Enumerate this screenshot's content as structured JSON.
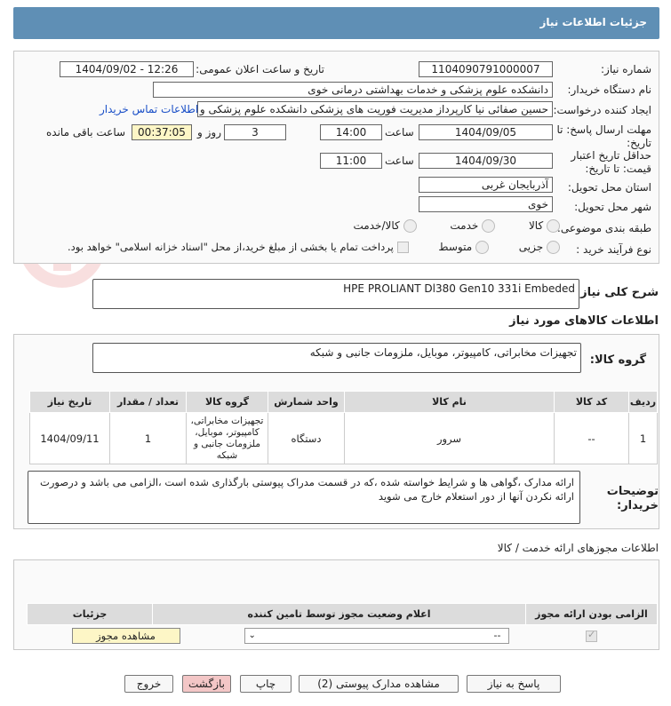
{
  "page_title": "جزئیات اطلاعات نیاز",
  "fields": {
    "need_number": {
      "label": "شماره نیاز:",
      "value": "1104090791000007"
    },
    "announce_datetime": {
      "label": "تاریخ و ساعت اعلان عمومی:",
      "value": "1404/09/02 - 12:26"
    },
    "buyer_org": {
      "label": "نام دستگاه خریدار:",
      "value": "دانشکده علوم پزشکی و خدمات بهداشتی درمانی خوی"
    },
    "requester": {
      "label": "ایجاد کننده درخواست:",
      "value": "حسین صفائی نیا کارپرداز مدیریت فوریت های پزشکی دانشکده علوم پزشکی و خدمات"
    },
    "contact_link": "اطلاعات تماس خریدار",
    "reply_deadline": {
      "label": "مهلت ارسال پاسخ: تا تاریخ:",
      "date": "1404/09/05",
      "time_label": "ساعت",
      "time": "14:00",
      "days": "3",
      "days_label": "روز و",
      "remaining": "00:37:05",
      "remaining_label": "ساعت باقی مانده"
    },
    "price_validity": {
      "label": "حداقل تاریخ اعتبار قیمت: تا تاریخ:",
      "date": "1404/09/30",
      "time_label": "ساعت",
      "time": "11:00"
    },
    "province": {
      "label": "استان محل تحویل:",
      "value": "آذربایجان غربی"
    },
    "city": {
      "label": "شهر محل تحویل:",
      "value": "خوی"
    },
    "category": {
      "label": "طبقه بندی موضوعی:",
      "options": [
        "کالا",
        "خدمت",
        "کالا/خدمت"
      ]
    },
    "process": {
      "label": "نوع فرآیند خرید :",
      "options": [
        "جزیی",
        "متوسط"
      ],
      "payment_note": "پرداخت تمام یا بخشی از مبلغ خرید،از محل \"اسناد خزانه اسلامی\" خواهد بود."
    }
  },
  "summary": {
    "label": "شرح کلی نیاز:",
    "value": "HPE PROLIANT Dl380 Gen10 331i Embeded"
  },
  "goods_info_title": "اطلاعات کالاهای مورد نیاز",
  "goods_group": {
    "label": "گروه کالا:",
    "value": "تجهیزات مخابراتی، کامپیوتر، موبایل، ملزومات جانبی و شبکه"
  },
  "goods_table": {
    "headers": [
      "ردیف",
      "کد کالا",
      "نام کالا",
      "واحد شمارش",
      "گروه کالا",
      "تعداد / مقدار",
      "تاریخ نیاز"
    ],
    "rows": [
      [
        "1",
        "--",
        "سرور",
        "دستگاه",
        "تجهیزات مخابراتی، کامپیوتر، موبایل، ملزومات جانبی و شبکه",
        "1",
        "1404/09/11"
      ]
    ]
  },
  "buyer_notes": {
    "label": "توضیحات خریدار:",
    "value": "ارائه مدارک ،گواهی ها و شرایط خواسته شده ،که در قسمت مدراک پیوستی بارگذاری شده است ،الزامی می باشد و درصورت ارائه نکردن آنها از دور استعلام خارج می شوید"
  },
  "permits_title": "اطلاعات مجوزهای ارائه خدمت / کالا",
  "permits_table": {
    "headers": [
      "الزامی بودن ارائه مجوز",
      "اعلام وضعیت مجوز توسط تامین کننده",
      "جزئیات"
    ],
    "select_value": "--",
    "details_button": "مشاهده مجوز"
  },
  "buttons": {
    "reply": "پاسخ به نیاز",
    "attachments": "مشاهده مدارک پیوستی (2)",
    "print": "چاپ",
    "back": "بازگشت",
    "exit": "خروج"
  },
  "colors": {
    "accent_header": "#5f8fb5",
    "link": "#1a4fc7",
    "yellow": "#fdf6c6",
    "table_header": "#dcdcdc",
    "back_red": "#f3c6c6"
  }
}
